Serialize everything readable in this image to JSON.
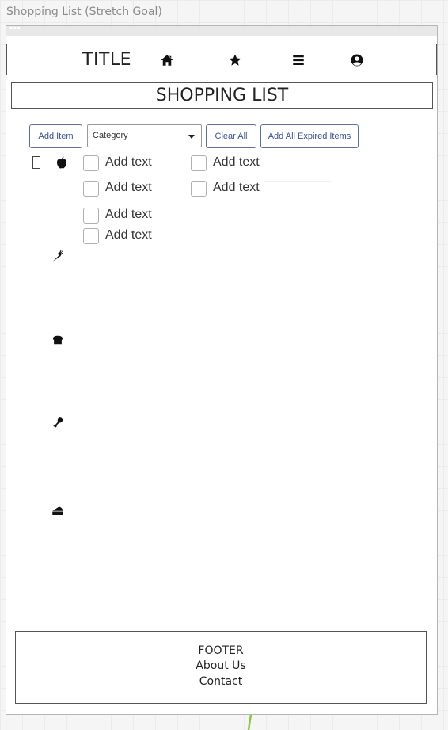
{
  "canvas": {
    "title": "Shopping List (Stretch Goal)"
  },
  "navbar": {
    "title": "TITLE",
    "icons": [
      "home-icon",
      "star-icon",
      "menu-icon",
      "user-circle-icon"
    ]
  },
  "header": {
    "title": "SHOPPING LIST"
  },
  "toolbar": {
    "add_item_label": "Add Item",
    "category_selected": "Category",
    "clear_all_label": "Clear All",
    "add_expired_label": "Add All Expired Items"
  },
  "categories": [
    {
      "icon": "apple-icon"
    },
    {
      "icon": "carrot-icon"
    },
    {
      "icon": "bread-icon"
    },
    {
      "icon": "meat-drumstick-icon"
    },
    {
      "icon": "cheese-icon"
    }
  ],
  "items": [
    {
      "label": "Add text",
      "checked": false
    },
    {
      "label": "Add text",
      "checked": false
    },
    {
      "label": "Add text",
      "checked": false
    },
    {
      "label": "Add text",
      "checked": false
    },
    {
      "label": "Add text",
      "checked": false
    },
    {
      "label": "Add text",
      "checked": false
    }
  ],
  "footer": {
    "title": "FOOTER",
    "about_link": "About Us",
    "contact_link": "Contact"
  },
  "colors": {
    "button_border": "#5b6ea6",
    "button_text": "#3b4f99",
    "connector": "#8cc63f"
  }
}
